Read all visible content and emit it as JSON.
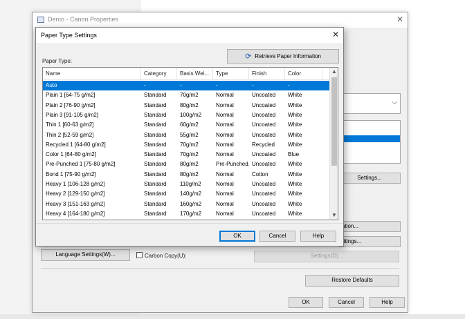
{
  "background_window": {
    "title": "Demo - Canon Properties",
    "close_glyph": "✕",
    "settings_btn": "Settings...",
    "btn_partial1": "ation...",
    "btn_partial2": "ettings...",
    "language_btn": "Language Settings(W)...",
    "carbon_copy": "Carbon Copy(U):",
    "carbon_settings_btn": "Settings(D)...",
    "restore_btn": "Restore Defaults",
    "ok": "OK",
    "cancel": "Cancel",
    "help": "Help",
    "dropdown_chevron": "⌵"
  },
  "dialog": {
    "title": "Paper Type Settings",
    "close_glyph": "✕",
    "retrieve_label": "Retrieve Paper Information",
    "retrieve_icon": "refresh-icon",
    "paper_type_label": "Paper Type:",
    "columns": [
      "Name",
      "Category",
      "Basis Wei...",
      "Type",
      "Finish",
      "Color"
    ],
    "rows": [
      [
        "Auto",
        "-",
        "-",
        "-",
        "-",
        "-"
      ],
      [
        "Plain 1 [64-75 g/m2]",
        "Standard",
        "70g/m2",
        "Normal",
        "Uncoated",
        "White"
      ],
      [
        "Plain 2 [76-90 g/m2]",
        "Standard",
        "80g/m2",
        "Normal",
        "Uncoated",
        "White"
      ],
      [
        "Plain 3 [91-105 g/m2]",
        "Standard",
        "100g/m2",
        "Normal",
        "Uncoated",
        "White"
      ],
      [
        "Thin 1 [60-63 g/m2]",
        "Standard",
        "60g/m2",
        "Normal",
        "Uncoated",
        "White"
      ],
      [
        "Thin 2 [52-59 g/m2]",
        "Standard",
        "55g/m2",
        "Normal",
        "Uncoated",
        "White"
      ],
      [
        "Recycled 1 [64-80 g/m2]",
        "Standard",
        "70g/m2",
        "Normal",
        "Recycled",
        "White"
      ],
      [
        "Color 1 [64-80 g/m2]",
        "Standard",
        "70g/m2",
        "Normal",
        "Uncoated",
        "Blue"
      ],
      [
        "Pre-Punched 1 [75-80 g/m2]",
        "Standard",
        "80g/m2",
        "Pre-Punched...",
        "Uncoated",
        "White"
      ],
      [
        "Bond 1 [75-90 g/m2]",
        "Standard",
        "80g/m2",
        "Normal",
        "Cotton",
        "White"
      ],
      [
        "Heavy 1 [106-128 g/m2]",
        "Standard",
        "110g/m2",
        "Normal",
        "Uncoated",
        "White"
      ],
      [
        "Heavy 2 [129-150 g/m2]",
        "Standard",
        "140g/m2",
        "Normal",
        "Uncoated",
        "White"
      ],
      [
        "Heavy 3 [151-163 g/m2]",
        "Standard",
        "160g/m2",
        "Normal",
        "Uncoated",
        "White"
      ],
      [
        "Heavy 4 [164-180 g/m2]",
        "Standard",
        "170g/m2",
        "Normal",
        "Uncoated",
        "White"
      ]
    ],
    "selected_row": 0,
    "ok": "OK",
    "cancel": "Cancel",
    "help": "Help",
    "scroll_up_glyph": "▲",
    "scroll_down_glyph": "▼"
  },
  "colors": {
    "selection": "#0078d7",
    "dialog_bg": "#f0f0f0"
  }
}
